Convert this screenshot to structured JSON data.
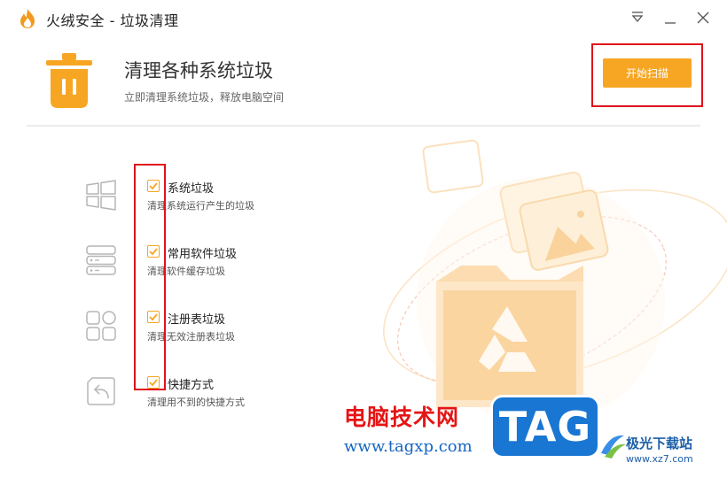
{
  "window": {
    "title": "火绒安全 - 垃圾清理",
    "logo_icon": "huorong-flame-icon",
    "controls": [
      "menu-icon",
      "minimize-icon",
      "close-icon"
    ]
  },
  "header": {
    "icon": "trash-bin-icon",
    "title": "清理各种系统垃圾",
    "subtitle": "立即清理系统垃圾，释放电脑空间",
    "scan_button": "开始扫描"
  },
  "items": [
    {
      "icon": "windows-logo-icon",
      "title": "系统垃圾",
      "desc": "清理系统运行产生的垃圾",
      "checked": true
    },
    {
      "icon": "software-stack-icon",
      "title": "常用软件垃圾",
      "desc": "清理软件缓存垃圾",
      "checked": true
    },
    {
      "icon": "registry-grid-icon",
      "title": "注册表垃圾",
      "desc": "清理无效注册表垃圾",
      "checked": true
    },
    {
      "icon": "shortcut-arrow-icon",
      "title": "快捷方式",
      "desc": "清理用不到的快捷方式",
      "checked": true
    }
  ],
  "watermark": {
    "text": "电脑技术网",
    "url": "www.tagxp.com",
    "tag": "TAG",
    "site_name": "极光下载站",
    "site_url": "www.xz7.com"
  },
  "colors": {
    "accent": "#f7a623",
    "highlight_box": "#e0101b",
    "icon_gray": "#b5b5b5"
  }
}
